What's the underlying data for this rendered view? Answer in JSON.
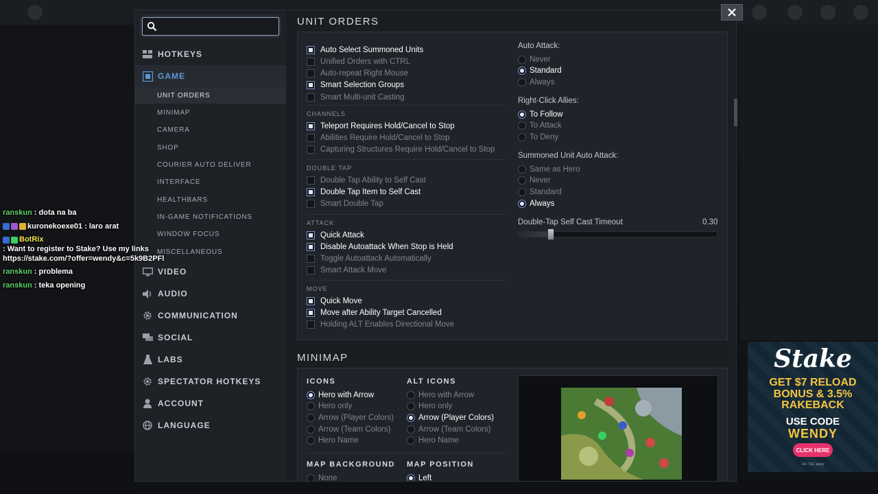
{
  "search": {
    "placeholder": ""
  },
  "nav": {
    "hotkeys": "HOTKEYS",
    "game": "GAME",
    "game_sub": [
      "UNIT ORDERS",
      "MINIMAP",
      "CAMERA",
      "SHOP",
      "COURIER AUTO DELIVER",
      "INTERFACE",
      "HEALTHBARS",
      "IN-GAME NOTIFICATIONS",
      "WINDOW FOCUS",
      "MISCELLANEOUS"
    ],
    "video": "VIDEO",
    "audio": "AUDIO",
    "communication": "COMMUNICATION",
    "social": "SOCIAL",
    "labs": "LABS",
    "spectator_hotkeys": "SPECTATOR HOTKEYS",
    "account": "ACCOUNT",
    "language": "LANGUAGE"
  },
  "unit_orders": {
    "title": "UNIT ORDERS",
    "general": [
      {
        "label": "Auto Select Summoned Units",
        "checked": true
      },
      {
        "label": "Unified Orders with CTRL",
        "checked": false
      },
      {
        "label": "Auto-repeat Right Mouse",
        "checked": false
      },
      {
        "label": "Smart Selection Groups",
        "checked": true
      },
      {
        "label": "Smart Multi-unit Casting",
        "checked": false
      }
    ],
    "channels_label": "CHANNELS",
    "channels": [
      {
        "label": "Teleport Requires Hold/Cancel to Stop",
        "checked": true
      },
      {
        "label": "Abilities Require Hold/Cancel to Stop",
        "checked": false
      },
      {
        "label": "Capturing Structures Require Hold/Cancel to Stop",
        "checked": false
      }
    ],
    "double_tap_label": "DOUBLE TAP",
    "double_tap": [
      {
        "label": "Double Tap Ability to Self Cast",
        "checked": false
      },
      {
        "label": "Double Tap Item to Self Cast",
        "checked": true
      },
      {
        "label": "Smart Double Tap",
        "checked": false
      }
    ],
    "attack_label": "ATTACK",
    "attack": [
      {
        "label": "Quick Attack",
        "checked": true
      },
      {
        "label": "Disable Autoattack When Stop is Held",
        "checked": true
      },
      {
        "label": "Toggle Autoattack Automatically",
        "checked": false
      },
      {
        "label": "Smart Attack Move",
        "checked": false
      }
    ],
    "move_label": "MOVE",
    "move": [
      {
        "label": "Quick Move",
        "checked": true
      },
      {
        "label": "Move after Ability Target Cancelled",
        "checked": true
      },
      {
        "label": "Holding ALT Enables Directional Move",
        "checked": false
      }
    ],
    "auto_attack_label": "Auto Attack:",
    "auto_attack": [
      {
        "label": "Never",
        "selected": false
      },
      {
        "label": "Standard",
        "selected": true
      },
      {
        "label": "Always",
        "selected": false
      }
    ],
    "right_click_label": "Right-Click Allies:",
    "right_click": [
      {
        "label": "To Follow",
        "selected": true
      },
      {
        "label": "To Attack",
        "selected": false
      },
      {
        "label": "To Deny",
        "selected": false
      }
    ],
    "summoned_label": "Summoned Unit Auto Attack:",
    "summoned": [
      {
        "label": "Same as Hero",
        "selected": false
      },
      {
        "label": "Never",
        "selected": false
      },
      {
        "label": "Standard",
        "selected": false
      },
      {
        "label": "Always",
        "selected": true
      }
    ],
    "timeout_label": "Double-Tap Self Cast Timeout",
    "timeout_value": "0.30",
    "timeout_fraction": 0.16
  },
  "minimap": {
    "title": "MINIMAP",
    "icons_label": "ICONS",
    "icons": [
      {
        "label": "Hero with Arrow",
        "selected": true
      },
      {
        "label": "Hero only",
        "selected": false
      },
      {
        "label": "Arrow (Player Colors)",
        "selected": false
      },
      {
        "label": "Arrow (Team Colors)",
        "selected": false
      },
      {
        "label": "Hero Name",
        "selected": false
      }
    ],
    "alt_icons_label": "ALT ICONS",
    "alt_icons": [
      {
        "label": "Hero with Arrow",
        "selected": false
      },
      {
        "label": "Hero only",
        "selected": false
      },
      {
        "label": "Arrow (Player Colors)",
        "selected": true
      },
      {
        "label": "Arrow (Team Colors)",
        "selected": false
      },
      {
        "label": "Hero Name",
        "selected": false
      }
    ],
    "background_label": "MAP BACKGROUND",
    "background_first": "None",
    "position_label": "MAP POSITION",
    "position_first": "Left"
  },
  "chat": [
    {
      "user": "ranskun",
      "user_color": "#5fd16a",
      "text": ": dota na ba"
    },
    {
      "user": "kuronekoexe01",
      "user_color": "#ffffff",
      "text": ": laro arat"
    },
    {
      "user": "BotRix",
      "user_color": "#f2e94e",
      "text": ": Want to register to Stake? Use my links https://stake.com/?offer=wendy&c=5k9B2PFl"
    },
    {
      "user": "ranskun",
      "user_color": "#5fd16a",
      "text": ": problema"
    },
    {
      "user": "ranskun",
      "user_color": "#5fd16a",
      "text": ": teka opening"
    }
  ],
  "ad": {
    "logo": "Stake",
    "line1": "GET $7 RELOAD",
    "line2": "BONUS & 3.5%",
    "line3": "RAKEBACK",
    "code_label": "USE CODE",
    "code": "WENDY",
    "cta": "CLICK HERE",
    "fine": "18+ T&C apply"
  },
  "colors": {
    "accent": "#5c98d4",
    "panel": "#20242a",
    "window": "#1a1d21"
  }
}
